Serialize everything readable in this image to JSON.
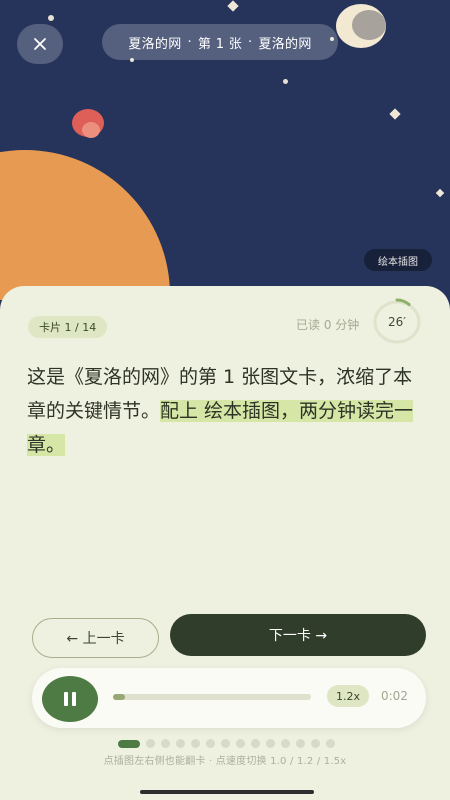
{
  "header": {
    "title_parts": [
      "夏洛的网",
      "第 1 张",
      "夏洛的网"
    ],
    "separator": "·",
    "illustration_label": "绘本插图"
  },
  "card": {
    "counter": "卡片 1 / 14",
    "read_status": "已读 0 分钟",
    "timer_label": "26′",
    "timer_progress": 0.1,
    "text_plain": "这是《夏洛的网》的第 1 张图文卡，浓缩了本章的关键情节。",
    "text_highlight": "配上 绘本插图，两分钟读完一章。"
  },
  "navigation": {
    "prev_label": "← 上一卡",
    "next_label": "下一卡 →"
  },
  "player": {
    "state": "playing",
    "progress": 0.01,
    "speed": "1.2x",
    "elapsed": "0:02"
  },
  "pagination": {
    "total": 14,
    "current": 1
  },
  "hint": "点插图左右侧也能翻卡 · 点速度切换 1.0 / 1.2 / 1.5x",
  "colors": {
    "sky": "#26335a",
    "sheet": "#eef0e0",
    "accent_green": "#4e7a43",
    "dark_button": "#2f3d2a",
    "highlight": "#d5e6a6"
  }
}
